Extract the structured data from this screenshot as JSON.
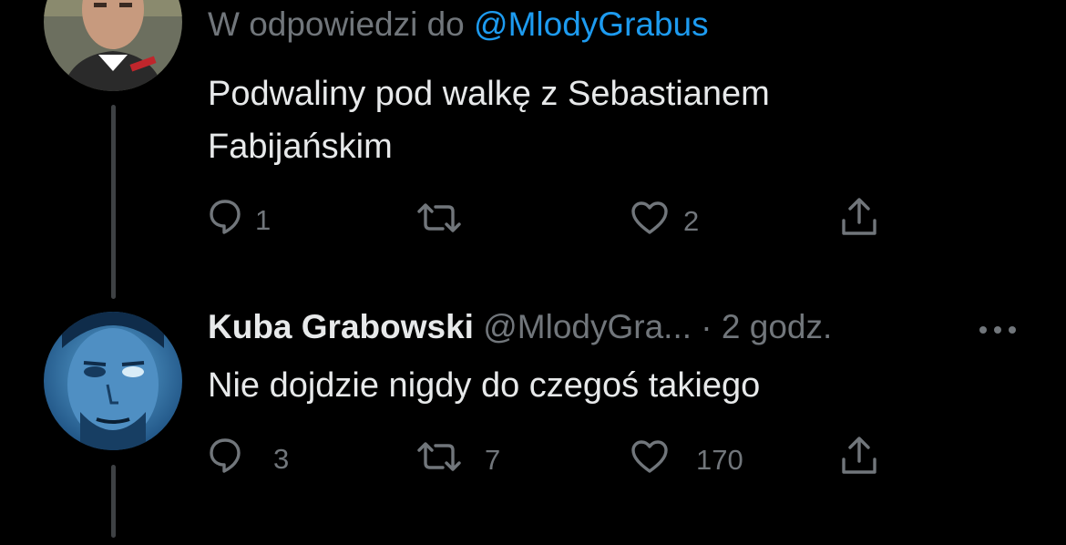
{
  "first_tweet": {
    "reply_prefix": "W odpowiedzi do",
    "reply_mention": "@MlodyGrabus",
    "text_line1": "Podwaliny pod walkę z Sebastianem",
    "text_line2": "Fabijańskim",
    "actions": {
      "reply_count": "1",
      "retweet_count": "",
      "like_count": "2"
    }
  },
  "second_tweet": {
    "author_name": "Kuba Grabowski",
    "author_handle": "@MlodyGra...",
    "separator": "·",
    "time": "2 godz.",
    "text": "Nie dojdzie nigdy do czegoś takiego",
    "actions": {
      "reply_count": "3",
      "retweet_count": "7",
      "like_count": "170"
    }
  },
  "icons": {
    "reply": "speech-bubble-icon",
    "retweet": "retweet-arrows-icon",
    "like": "heart-icon",
    "share": "share-upload-icon",
    "more": "more-dots-icon"
  },
  "colors": {
    "background": "#000000",
    "text_primary": "#e7e9ea",
    "text_secondary": "#71767b",
    "accent": "#1d9bf0",
    "thread_line": "#3e4144"
  }
}
